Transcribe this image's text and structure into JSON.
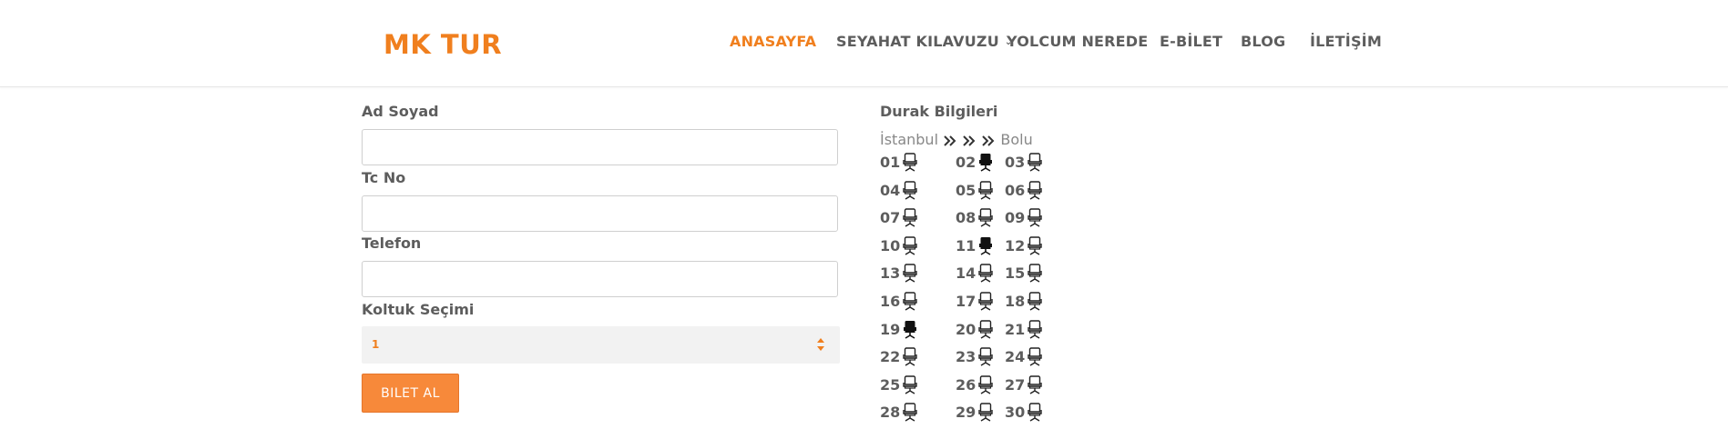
{
  "header": {
    "logo": "MK TUR",
    "nav": [
      {
        "label": "ANASAYFA",
        "active": true,
        "dropdown": false
      },
      {
        "label": "SEYAHAT KILAVUZU",
        "active": false,
        "dropdown": true
      },
      {
        "label": "YOLCUM NEREDE",
        "active": false,
        "dropdown": false
      },
      {
        "label": "E-BİLET",
        "active": false,
        "dropdown": false
      },
      {
        "label": "BLOG",
        "active": false,
        "dropdown": false
      },
      {
        "label": "İLETİŞİM",
        "active": false,
        "dropdown": false
      }
    ]
  },
  "form": {
    "name_label": "Ad Soyad",
    "name_value": "",
    "tc_label": "Tc No",
    "tc_value": "",
    "phone_label": "Telefon",
    "phone_value": "",
    "seat_label": "Koltuk Seçimi",
    "seat_value": "1",
    "submit_label": "BILET AL"
  },
  "stops": {
    "title": "Durak Bilgileri",
    "from": "İstanbul",
    "to": "Bolu"
  },
  "seats": [
    {
      "num": "01",
      "taken": false
    },
    {
      "num": "02",
      "taken": true
    },
    {
      "num": "03",
      "taken": false
    },
    {
      "num": "04",
      "taken": false
    },
    {
      "num": "05",
      "taken": false
    },
    {
      "num": "06",
      "taken": false
    },
    {
      "num": "07",
      "taken": false
    },
    {
      "num": "08",
      "taken": false
    },
    {
      "num": "09",
      "taken": false
    },
    {
      "num": "10",
      "taken": false
    },
    {
      "num": "11",
      "taken": true
    },
    {
      "num": "12",
      "taken": false
    },
    {
      "num": "13",
      "taken": false
    },
    {
      "num": "14",
      "taken": false
    },
    {
      "num": "15",
      "taken": false
    },
    {
      "num": "16",
      "taken": false
    },
    {
      "num": "17",
      "taken": false
    },
    {
      "num": "18",
      "taken": false
    },
    {
      "num": "19",
      "taken": true
    },
    {
      "num": "20",
      "taken": false
    },
    {
      "num": "21",
      "taken": false
    },
    {
      "num": "22",
      "taken": false
    },
    {
      "num": "23",
      "taken": false
    },
    {
      "num": "24",
      "taken": false
    },
    {
      "num": "25",
      "taken": false
    },
    {
      "num": "26",
      "taken": false
    },
    {
      "num": "27",
      "taken": false
    },
    {
      "num": "28",
      "taken": false
    },
    {
      "num": "29",
      "taken": false
    },
    {
      "num": "30",
      "taken": false
    }
  ],
  "colors": {
    "accent": "#f07f1e",
    "button": "#f7893a",
    "text": "#5d5d5d",
    "select_bg": "#f2f2f2"
  }
}
